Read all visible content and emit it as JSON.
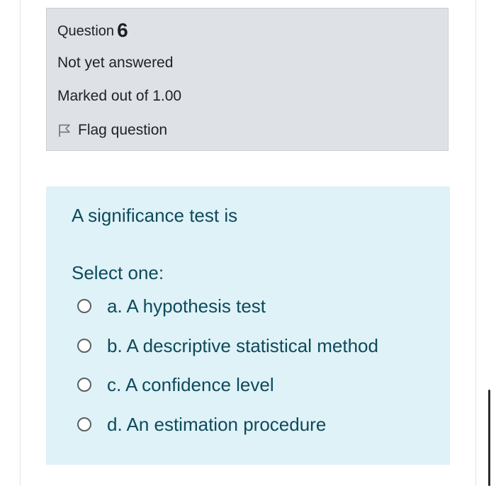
{
  "question_info": {
    "heading_label": "Question",
    "number": "6",
    "state": "Not yet answered",
    "grade": "Marked out of 1.00",
    "flag_label": "Flag question"
  },
  "question": {
    "text": "A significance test is",
    "prompt": "Select one:",
    "answers": [
      {
        "label": "a. A hypothesis test",
        "selected": false
      },
      {
        "label": "b. A descriptive statistical method",
        "selected": false
      },
      {
        "label": "c. A confidence level",
        "selected": false
      },
      {
        "label": "d. An estimation procedure",
        "selected": false
      }
    ]
  },
  "colors": {
    "info_bg": "#dee2e6",
    "content_bg": "#def2f8",
    "content_text": "#0f4a5a",
    "info_text": "#1d2125"
  },
  "icons": {
    "flag": "flag-icon",
    "radio": "radio-button-icon"
  }
}
